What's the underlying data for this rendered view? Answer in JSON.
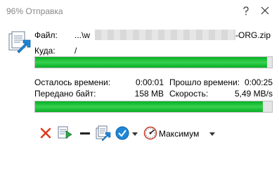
{
  "window": {
    "title": "96% Отправка"
  },
  "transfer": {
    "file_label": "Файл:",
    "file_prefix": "...\\w",
    "file_suffix": "-ORG.zip",
    "dest_label": "Куда:",
    "dest_value": "/",
    "file_progress": 0.98,
    "total_progress": 0.96
  },
  "stats": {
    "remaining_label": "Осталось времени:",
    "remaining_value": "0:00:01",
    "elapsed_label": "Прошло времени:",
    "elapsed_value": "0:00:25",
    "transferred_label": "Передано байт:",
    "transferred_value": "158 MB",
    "speed_label": "Скорость:",
    "speed_value": "5,49 MB/s"
  },
  "toolbar": {
    "speed_limit_label": "Максимум"
  },
  "colors": {
    "progress": "#06b025",
    "cancel": "#e03a1e"
  }
}
